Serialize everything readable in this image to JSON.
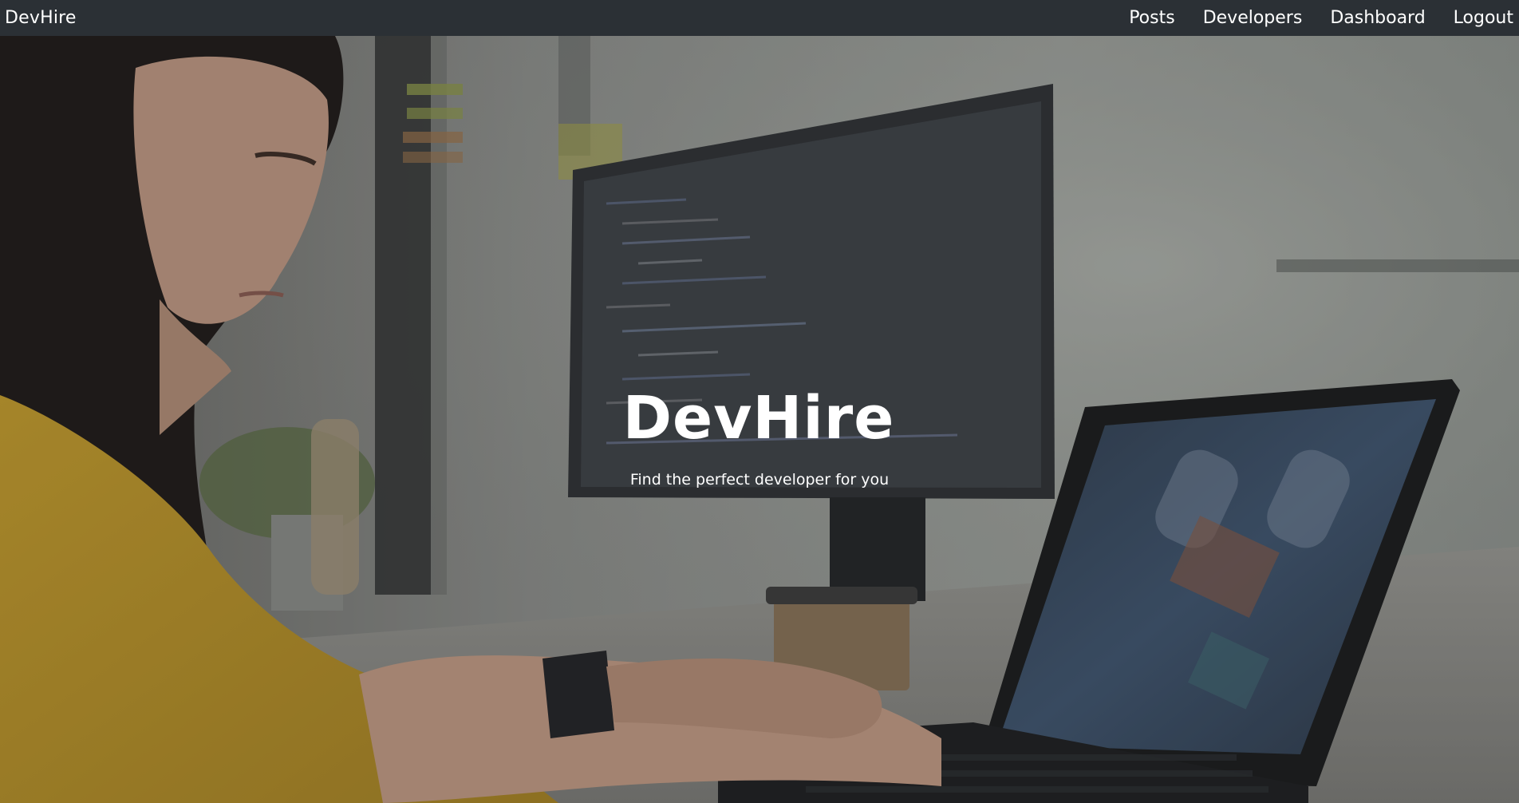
{
  "navbar": {
    "brand": "DevHire",
    "links": [
      {
        "label": "Posts"
      },
      {
        "label": "Developers"
      },
      {
        "label": "Dashboard"
      },
      {
        "label": "Logout"
      }
    ]
  },
  "hero": {
    "title": "DevHire",
    "subtitle": "Find the perfect developer for you",
    "background_image": "woman-coding-at-laptop-photo"
  },
  "colors": {
    "navbar_bg": "#2b3035",
    "text": "#ffffff"
  }
}
